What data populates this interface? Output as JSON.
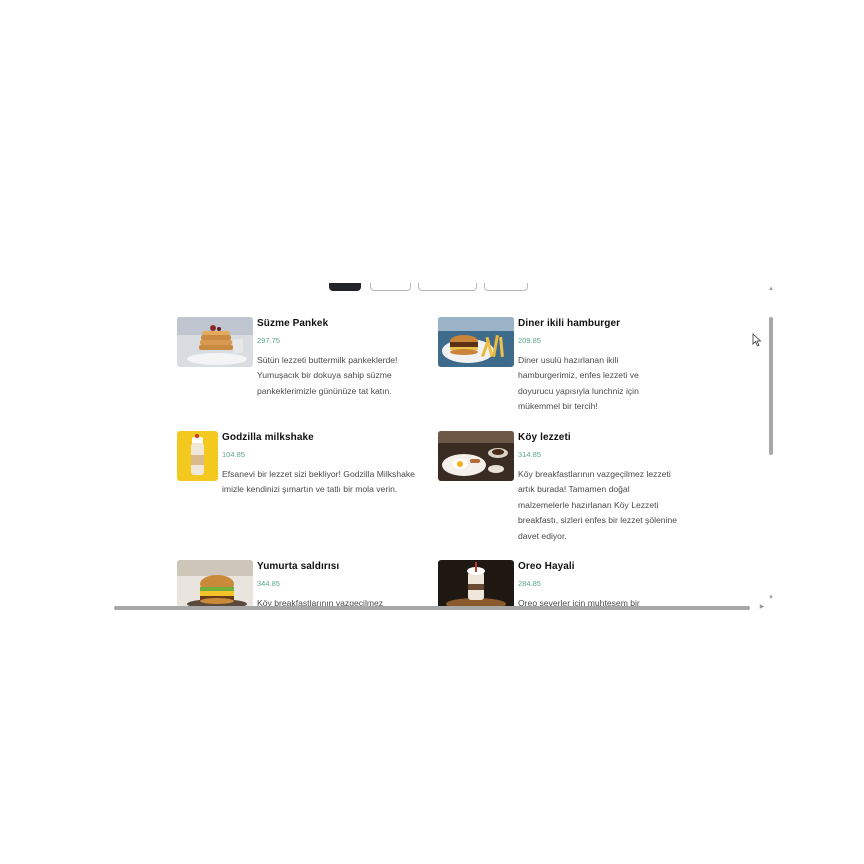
{
  "menu": {
    "items": [
      {
        "title": "Süzme Pankek",
        "price": "297.75",
        "desc": "Sütün lezzeti buttermilk pankeklerde! Yumuşacık bir dokuya sahip süzme pankeklerimizle gününüze tat katın.",
        "image_icon": "pancake-stack-image"
      },
      {
        "title": "Diner ikili hamburger",
        "price": "209.85",
        "desc": "Diner usulü hazırlanan ikili hamburgerimiz, enfes lezzeti ve doyurucu yapısıyla lunchniz için mükemmel bir tercih!",
        "image_icon": "burger-and-fries-image"
      },
      {
        "title": "Godzilla milkshake",
        "price": "104.85",
        "desc": "Efsanevi bir lezzet sizi bekliyor! Godzilla Milkshake imizle kendinizi şımartın ve tatlı bir mola verin.",
        "image_icon": "milkshake-image"
      },
      {
        "title": "Köy lezzeti",
        "price": "314.85",
        "desc": "Köy breakfastlarının vazgeçilmez lezzeti artık burada! Tamamen doğal malzemelerle hazırlanan Köy Lezzeti breakfastı, sizleri enfes bir lezzet şölenine davet ediyor.",
        "image_icon": "breakfast-plate-image"
      },
      {
        "title": "Yumurta saldırısı",
        "price": "344.85",
        "desc": "Köy breakfastlarının vazgeçilmez",
        "image_icon": "egg-burger-image"
      },
      {
        "title": "Oreo Hayali",
        "price": "284.85",
        "desc": "Oreo severler için muhteşem bir",
        "image_icon": "oreo-shake-image"
      }
    ]
  },
  "colors": {
    "price": "#5aa58a",
    "active_filter": "#212529",
    "scrollbar": "#a8a8a8"
  }
}
